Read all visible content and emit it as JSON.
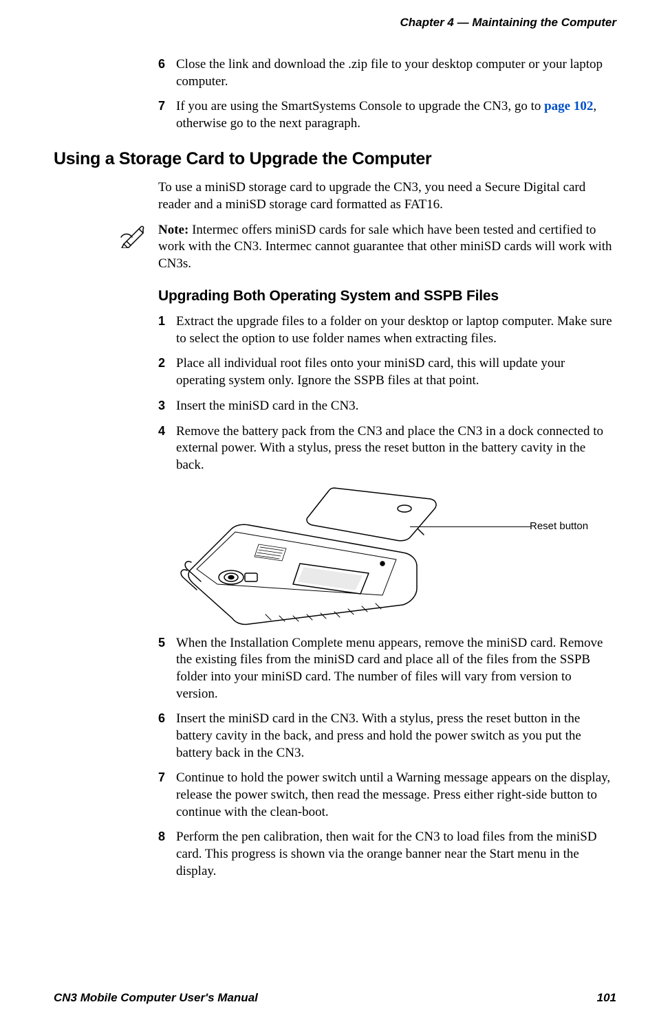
{
  "header": {
    "chapter": "Chapter 4 —  Maintaining the Computer"
  },
  "footer": {
    "manual": "CN3 Mobile Computer User's Manual",
    "page": "101"
  },
  "pre_list": [
    {
      "num": "6",
      "text": "Close the link and download the .zip file to your desktop computer or your laptop computer."
    },
    {
      "num": "7",
      "text_before_link": "If you are using the SmartSystems Console to upgrade the CN3, go to ",
      "link": "page 102",
      "text_after_link": ", otherwise go to the next paragraph."
    }
  ],
  "heading_1": "Using a Storage Card to Upgrade the Computer",
  "intro_para": "To use a miniSD storage card to upgrade the CN3, you need a Secure Digital card reader and a miniSD storage card formatted as FAT16.",
  "note": {
    "label": "Note:",
    "text": " Intermec offers miniSD cards for sale which have been tested and certified to work with the CN3. Intermec cannot guarantee that other miniSD cards will work with CN3s."
  },
  "heading_2": "Upgrading Both Operating System and SSPB Files",
  "steps": [
    {
      "num": "1",
      "text": "Extract the upgrade files to a folder on your desktop or laptop computer. Make sure to select the option to use folder names when extracting files."
    },
    {
      "num": "2",
      "text": "Place all individual root files onto your miniSD card, this will update your operating system only. Ignore the SSPB files at that point."
    },
    {
      "num": "3",
      "text": "Insert the miniSD card in the CN3."
    },
    {
      "num": "4",
      "text": "Remove the battery pack from the CN3 and place the CN3 in a dock connected to external power. With a stylus, press the reset button in the battery cavity in the back."
    },
    {
      "num": "5",
      "text": "When the Installation Complete menu appears, remove the miniSD card. Remove the existing files from the miniSD card and place all of the files from the SSPB folder into your miniSD card. The number of files will vary from version to version."
    },
    {
      "num": "6",
      "text": "Insert the miniSD card in the CN3. With a stylus, press the reset button in the battery cavity in the back, and press and hold the power switch as you put the battery back in the CN3."
    },
    {
      "num": "7",
      "text": "Continue to hold the power switch until a Warning message appears on the display, release the power switch, then read the message. Press either right-side button to continue with the clean-boot."
    },
    {
      "num": "8",
      "text": "Perform the pen calibration, then wait for the CN3 to load files from the miniSD card. This progress is shown via the orange banner near the Start menu in the display."
    }
  ],
  "figure": {
    "callout": "Reset button"
  }
}
